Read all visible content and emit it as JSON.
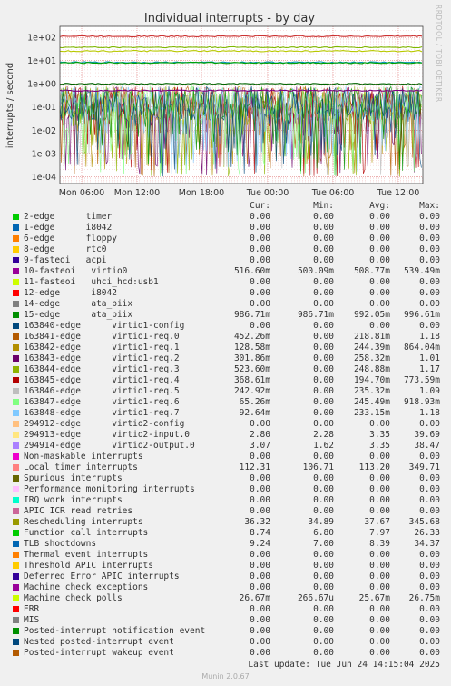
{
  "chart_data": {
    "type": "line",
    "title": "Individual interrupts - by day",
    "ylabel": "interrupts / second",
    "y_scale": "log",
    "ylim": [
      5e-05,
      300
    ],
    "y_ticks": [
      "1e+02",
      "1e+01",
      "1e+00",
      "1e-01",
      "1e-02",
      "1e-03",
      "1e-04"
    ],
    "x_ticks": [
      "Mon 06:00",
      "Mon 12:00",
      "Mon 18:00",
      "Tue 00:00",
      "Tue 06:00",
      "Tue 12:00"
    ],
    "grid": true,
    "series_levels": [
      {
        "name": "Local timer interrupts",
        "color": "#cc3333",
        "values": [
          113.2
        ]
      },
      {
        "name": "Rescheduling interrupts",
        "color": "#7fb800",
        "values": [
          37.67
        ]
      },
      {
        "name": "Machine check polls",
        "color": "#b8c800",
        "values": [
          25.67
        ]
      },
      {
        "name": "TLB shootdowns",
        "color": "#0090b0",
        "values": [
          8.39
        ]
      },
      {
        "name": "Function call interrupts",
        "color": "#00a000",
        "values": [
          7.97
        ]
      },
      {
        "name": "14-edge ata_piix",
        "color": "#006400",
        "values": [
          0.992
        ]
      },
      {
        "name": "10-fasteoi virtio0",
        "color": "#800080",
        "values": [
          0.509
        ]
      }
    ]
  },
  "side_credit": "RRDTOOL / TOBI OETIKER",
  "legend": {
    "headers": {
      "cur": "Cur:",
      "min": "Min:",
      "avg": "Avg:",
      "max": "Max:"
    },
    "rows": [
      {
        "label": "2-edge      timer",
        "color": "#00cc00",
        "cur": "0.00",
        "min": "0.00",
        "avg": "0.00",
        "max": "0.00"
      },
      {
        "label": "1-edge      i8042",
        "color": "#0066b3",
        "cur": "0.00",
        "min": "0.00",
        "avg": "0.00",
        "max": "0.00"
      },
      {
        "label": "6-edge      floppy",
        "color": "#ff8000",
        "cur": "0.00",
        "min": "0.00",
        "avg": "0.00",
        "max": "0.00"
      },
      {
        "label": "8-edge      rtc0",
        "color": "#ffcc00",
        "cur": "0.00",
        "min": "0.00",
        "avg": "0.00",
        "max": "0.00"
      },
      {
        "label": "9-fasteoi   acpi",
        "color": "#330099",
        "cur": "0.00",
        "min": "0.00",
        "avg": "0.00",
        "max": "0.00"
      },
      {
        "label": "10-fasteoi   virtio0",
        "color": "#990099",
        "cur": "516.60m",
        "min": "500.09m",
        "avg": "508.77m",
        "max": "539.49m"
      },
      {
        "label": "11-fasteoi   uhci_hcd:usb1",
        "color": "#ccff00",
        "cur": "0.00",
        "min": "0.00",
        "avg": "0.00",
        "max": "0.00"
      },
      {
        "label": "12-edge      i8042",
        "color": "#ff0000",
        "cur": "0.00",
        "min": "0.00",
        "avg": "0.00",
        "max": "0.00"
      },
      {
        "label": "14-edge      ata_piix",
        "color": "#808080",
        "cur": "0.00",
        "min": "0.00",
        "avg": "0.00",
        "max": "0.00"
      },
      {
        "label": "15-edge      ata_piix",
        "color": "#008f00",
        "cur": "986.71m",
        "min": "986.71m",
        "avg": "992.05m",
        "max": "996.61m"
      },
      {
        "label": "163840-edge      virtio1-config",
        "color": "#00487d",
        "cur": "0.00",
        "min": "0.00",
        "avg": "0.00",
        "max": "0.00"
      },
      {
        "label": "163841-edge      virtio1-req.0",
        "color": "#b35a00",
        "cur": "452.26m",
        "min": "0.00",
        "avg": "218.81m",
        "max": "1.18"
      },
      {
        "label": "163842-edge      virtio1-req.1",
        "color": "#b38f00",
        "cur": "128.58m",
        "min": "0.00",
        "avg": "244.39m",
        "max": "864.04m"
      },
      {
        "label": "163843-edge      virtio1-req.2",
        "color": "#6b006b",
        "cur": "301.86m",
        "min": "0.00",
        "avg": "258.32m",
        "max": "1.01"
      },
      {
        "label": "163844-edge      virtio1-req.3",
        "color": "#8fb300",
        "cur": "523.60m",
        "min": "0.00",
        "avg": "248.88m",
        "max": "1.17"
      },
      {
        "label": "163845-edge      virtio1-req.4",
        "color": "#b30000",
        "cur": "368.61m",
        "min": "0.00",
        "avg": "194.70m",
        "max": "773.59m"
      },
      {
        "label": "163846-edge      virtio1-req.5",
        "color": "#bebebe",
        "cur": "242.92m",
        "min": "0.00",
        "avg": "235.32m",
        "max": "1.09"
      },
      {
        "label": "163847-edge      virtio1-req.6",
        "color": "#80ff80",
        "cur": "65.26m",
        "min": "0.00",
        "avg": "245.49m",
        "max": "918.93m"
      },
      {
        "label": "163848-edge      virtio1-req.7",
        "color": "#80c9ff",
        "cur": "92.64m",
        "min": "0.00",
        "avg": "233.15m",
        "max": "1.18"
      },
      {
        "label": "294912-edge      virtio2-config",
        "color": "#ffc080",
        "cur": "0.00",
        "min": "0.00",
        "avg": "0.00",
        "max": "0.00"
      },
      {
        "label": "294913-edge      virtio2-input.0",
        "color": "#ffe680",
        "cur": "2.80",
        "min": "2.28",
        "avg": "3.35",
        "max": "39.69"
      },
      {
        "label": "294914-edge      virtio2-output.0",
        "color": "#aa80ff",
        "cur": "3.07",
        "min": "1.62",
        "avg": "3.35",
        "max": "38.47"
      },
      {
        "label": "Non-maskable interrupts",
        "color": "#ee00cc",
        "cur": "0.00",
        "min": "0.00",
        "avg": "0.00",
        "max": "0.00"
      },
      {
        "label": "Local timer interrupts",
        "color": "#ff8080",
        "cur": "112.31",
        "min": "106.71",
        "avg": "113.20",
        "max": "349.71"
      },
      {
        "label": "Spurious interrupts",
        "color": "#666600",
        "cur": "0.00",
        "min": "0.00",
        "avg": "0.00",
        "max": "0.00"
      },
      {
        "label": "Performance monitoring interrupts",
        "color": "#ffbfff",
        "cur": "0.00",
        "min": "0.00",
        "avg": "0.00",
        "max": "0.00"
      },
      {
        "label": "IRQ work interrupts",
        "color": "#00ffcc",
        "cur": "0.00",
        "min": "0.00",
        "avg": "0.00",
        "max": "0.00"
      },
      {
        "label": "APIC ICR read retries",
        "color": "#cc6699",
        "cur": "0.00",
        "min": "0.00",
        "avg": "0.00",
        "max": "0.00"
      },
      {
        "label": "Rescheduling interrupts",
        "color": "#999900",
        "cur": "36.32",
        "min": "34.89",
        "avg": "37.67",
        "max": "345.68"
      },
      {
        "label": "Function call interrupts",
        "color": "#00cc00",
        "cur": "8.74",
        "min": "6.80",
        "avg": "7.97",
        "max": "26.33"
      },
      {
        "label": "TLB shootdowns",
        "color": "#0066b3",
        "cur": "9.24",
        "min": "7.00",
        "avg": "8.39",
        "max": "34.37"
      },
      {
        "label": "Thermal event interrupts",
        "color": "#ff8000",
        "cur": "0.00",
        "min": "0.00",
        "avg": "0.00",
        "max": "0.00"
      },
      {
        "label": "Threshold APIC interrupts",
        "color": "#ffcc00",
        "cur": "0.00",
        "min": "0.00",
        "avg": "0.00",
        "max": "0.00"
      },
      {
        "label": "Deferred Error APIC interrupts",
        "color": "#330099",
        "cur": "0.00",
        "min": "0.00",
        "avg": "0.00",
        "max": "0.00"
      },
      {
        "label": "Machine check exceptions",
        "color": "#990099",
        "cur": "0.00",
        "min": "0.00",
        "avg": "0.00",
        "max": "0.00"
      },
      {
        "label": "Machine check polls",
        "color": "#ccff00",
        "cur": "26.67m",
        "min": "266.67u",
        "avg": "25.67m",
        "max": "26.75m"
      },
      {
        "label": "ERR",
        "color": "#ff0000",
        "cur": "0.00",
        "min": "0.00",
        "avg": "0.00",
        "max": "0.00"
      },
      {
        "label": "MIS",
        "color": "#808080",
        "cur": "0.00",
        "min": "0.00",
        "avg": "0.00",
        "max": "0.00"
      },
      {
        "label": "Posted-interrupt notification event",
        "color": "#008f00",
        "cur": "0.00",
        "min": "0.00",
        "avg": "0.00",
        "max": "0.00"
      },
      {
        "label": "Nested posted-interrupt event",
        "color": "#00487d",
        "cur": "0.00",
        "min": "0.00",
        "avg": "0.00",
        "max": "0.00"
      },
      {
        "label": "Posted-interrupt wakeup event",
        "color": "#b35a00",
        "cur": "0.00",
        "min": "0.00",
        "avg": "0.00",
        "max": "0.00"
      }
    ]
  },
  "last_update": "Last update: Tue Jun 24 14:15:04 2025",
  "munin_version": "Munin 2.0.67"
}
